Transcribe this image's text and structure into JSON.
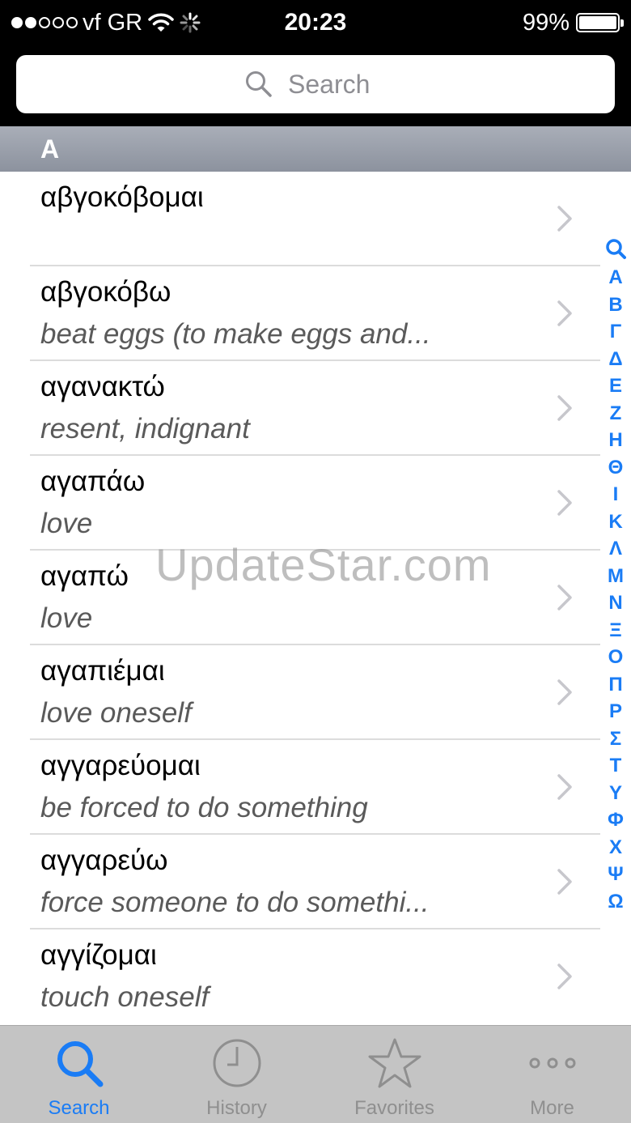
{
  "status_bar": {
    "carrier": "vf GR",
    "time": "20:23",
    "battery_percent": "99%",
    "battery_level": 0.99,
    "signal_bars_filled": 2,
    "signal_bars_total": 5
  },
  "search": {
    "placeholder": "Search"
  },
  "section_header": {
    "letter": "A"
  },
  "list": {
    "items": [
      {
        "word": "αβγοκόβομαι",
        "meaning": ""
      },
      {
        "word": "αβγοκόβω",
        "meaning": "beat eggs (to make eggs and..."
      },
      {
        "word": "αγανακτώ",
        "meaning": "resent, indignant"
      },
      {
        "word": "αγαπάω",
        "meaning": "love"
      },
      {
        "word": "αγαπώ",
        "meaning": "love"
      },
      {
        "word": "αγαπιέμαι",
        "meaning": "love oneself"
      },
      {
        "word": "αγγαρεύομαι",
        "meaning": "be forced to do something"
      },
      {
        "word": "αγγαρεύω",
        "meaning": "force someone to do somethi..."
      },
      {
        "word": "αγγίζομαι",
        "meaning": "touch oneself"
      }
    ]
  },
  "index_bar": {
    "letters": [
      "A",
      "B",
      "Γ",
      "Δ",
      "E",
      "Z",
      "H",
      "Θ",
      "I",
      "K",
      "Λ",
      "M",
      "N",
      "Ξ",
      "O",
      "Π",
      "P",
      "Σ",
      "T",
      "Y",
      "Φ",
      "X",
      "Ψ",
      "Ω"
    ]
  },
  "watermark": "UpdateStar.com",
  "tab_bar": {
    "tabs": [
      {
        "label": "Search",
        "icon": "search-icon",
        "active": true
      },
      {
        "label": "History",
        "icon": "clock-icon",
        "active": false
      },
      {
        "label": "Favorites",
        "icon": "star-icon",
        "active": false
      },
      {
        "label": "More",
        "icon": "more-dots-icon",
        "active": false
      }
    ]
  },
  "colors": {
    "accent": "#1a7cf5",
    "section_header": "#9aa0ab",
    "tab_bar": "#c4c4c4"
  }
}
